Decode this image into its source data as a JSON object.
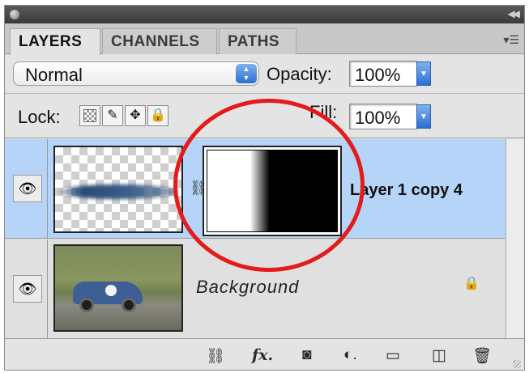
{
  "tabs": [
    {
      "label": "LAYERS",
      "active": true
    },
    {
      "label": "CHANNELS",
      "active": false
    },
    {
      "label": "PATHS",
      "active": false
    }
  ],
  "blend_mode": {
    "value": "Normal",
    "options_visible": [
      "Normal"
    ]
  },
  "opacity": {
    "label": "Opacity:",
    "value": "100%"
  },
  "lock": {
    "label": "Lock:",
    "icons": [
      "lock-transparent-pixels-icon",
      "lock-image-pixels-icon",
      "lock-position-icon",
      "lock-all-icon"
    ]
  },
  "fill": {
    "label": "Fill:",
    "value": "100%"
  },
  "layers": [
    {
      "name": "Layer 1 copy 4",
      "selected": true,
      "visible": true,
      "has_mask": true
    },
    {
      "name": "Background",
      "selected": false,
      "visible": true,
      "locked": true
    }
  ],
  "footer_icons": [
    "link-layers-icon",
    "layer-style-fx-icon",
    "add-mask-icon",
    "adjustment-layer-icon",
    "new-group-icon",
    "new-layer-icon",
    "delete-layer-icon"
  ],
  "colors": {
    "selection": "#b6d3f8",
    "annotation": "#e41b1b",
    "accent_blue": "#2a6fd6"
  }
}
